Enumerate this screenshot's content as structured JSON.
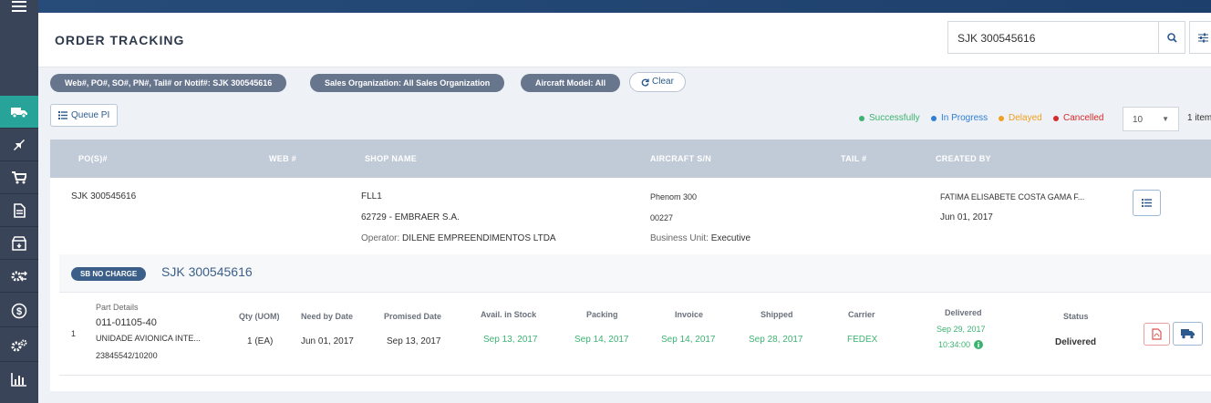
{
  "page": {
    "title": "ORDER TRACKING"
  },
  "search": {
    "value": "SJK 300545616"
  },
  "filters": {
    "chips": [
      "Web#, PO#, SO#, PN#, Tail# or Notif#: SJK 300545616",
      "Sales Organization: All Sales Organization",
      "Aircraft Model: All"
    ],
    "clear_label": "Clear"
  },
  "toolbar": {
    "queue_label": "Queue PI",
    "page_size": "10",
    "items_count": "1 item"
  },
  "legend": [
    {
      "label": "Successfully",
      "color": "#3cb371"
    },
    {
      "label": "In Progress",
      "color": "#2f7fd6"
    },
    {
      "label": "Delayed",
      "color": "#f0a020"
    },
    {
      "label": "Cancelled",
      "color": "#d62b2b"
    }
  ],
  "table": {
    "headers": {
      "po": "PO(S)#",
      "web": "WEB #",
      "shop": "SHOP NAME",
      "aircraft": "AIRCRAFT S/N",
      "tail": "TAIL #",
      "created": "CREATED BY"
    },
    "row": {
      "po": "SJK 300545616",
      "shop_name": "FLL1",
      "shop_code": "62729 - EMBRAER S.A.",
      "operator_label": "Operator:",
      "operator": "DILENE EMPREENDIMENTOS LTDA",
      "aircraft_model": "Phenom 300",
      "aircraft_sn": "00227",
      "bu_label": "Business Unit:",
      "bu": "Executive",
      "created_by": "FATIMA ELISABETE COSTA GAMA F...",
      "created_date": "Jun 01, 2017"
    }
  },
  "subpanel": {
    "badge": "SB NO CHARGE",
    "po": "SJK 300545616",
    "headers": {
      "part": "Part Details",
      "qty": "Qty (UOM)",
      "need": "Need by Date",
      "promised": "Promised Date",
      "avail": "Avail. in Stock",
      "packing": "Packing",
      "invoice": "Invoice",
      "shipped": "Shipped",
      "carrier": "Carrier",
      "delivered": "Delivered",
      "status": "Status"
    },
    "line": {
      "index": "1",
      "part_number": "011-01105-40",
      "part_desc": "UNIDADE AVIONICA INTE...",
      "part_ref": "23845542/10200",
      "qty": "1 (EA)",
      "need_by": "Jun 01, 2017",
      "promised": "Sep 13, 2017",
      "avail": "Sep 13, 2017",
      "packing": "Sep 14, 2017",
      "invoice": "Sep 14, 2017",
      "shipped": "Sep 28, 2017",
      "carrier": "FEDEX",
      "delivered_date": "Sep 29, 2017",
      "delivered_time": "10:34:00",
      "status": "Delivered"
    }
  },
  "sidebar": {
    "items": [
      "menu-icon",
      "truck-icon",
      "plane-icon",
      "cart-icon",
      "document-icon",
      "package-icon",
      "swap-gear-icon",
      "dollar-icon",
      "gears-icon",
      "bar-chart-icon"
    ]
  }
}
